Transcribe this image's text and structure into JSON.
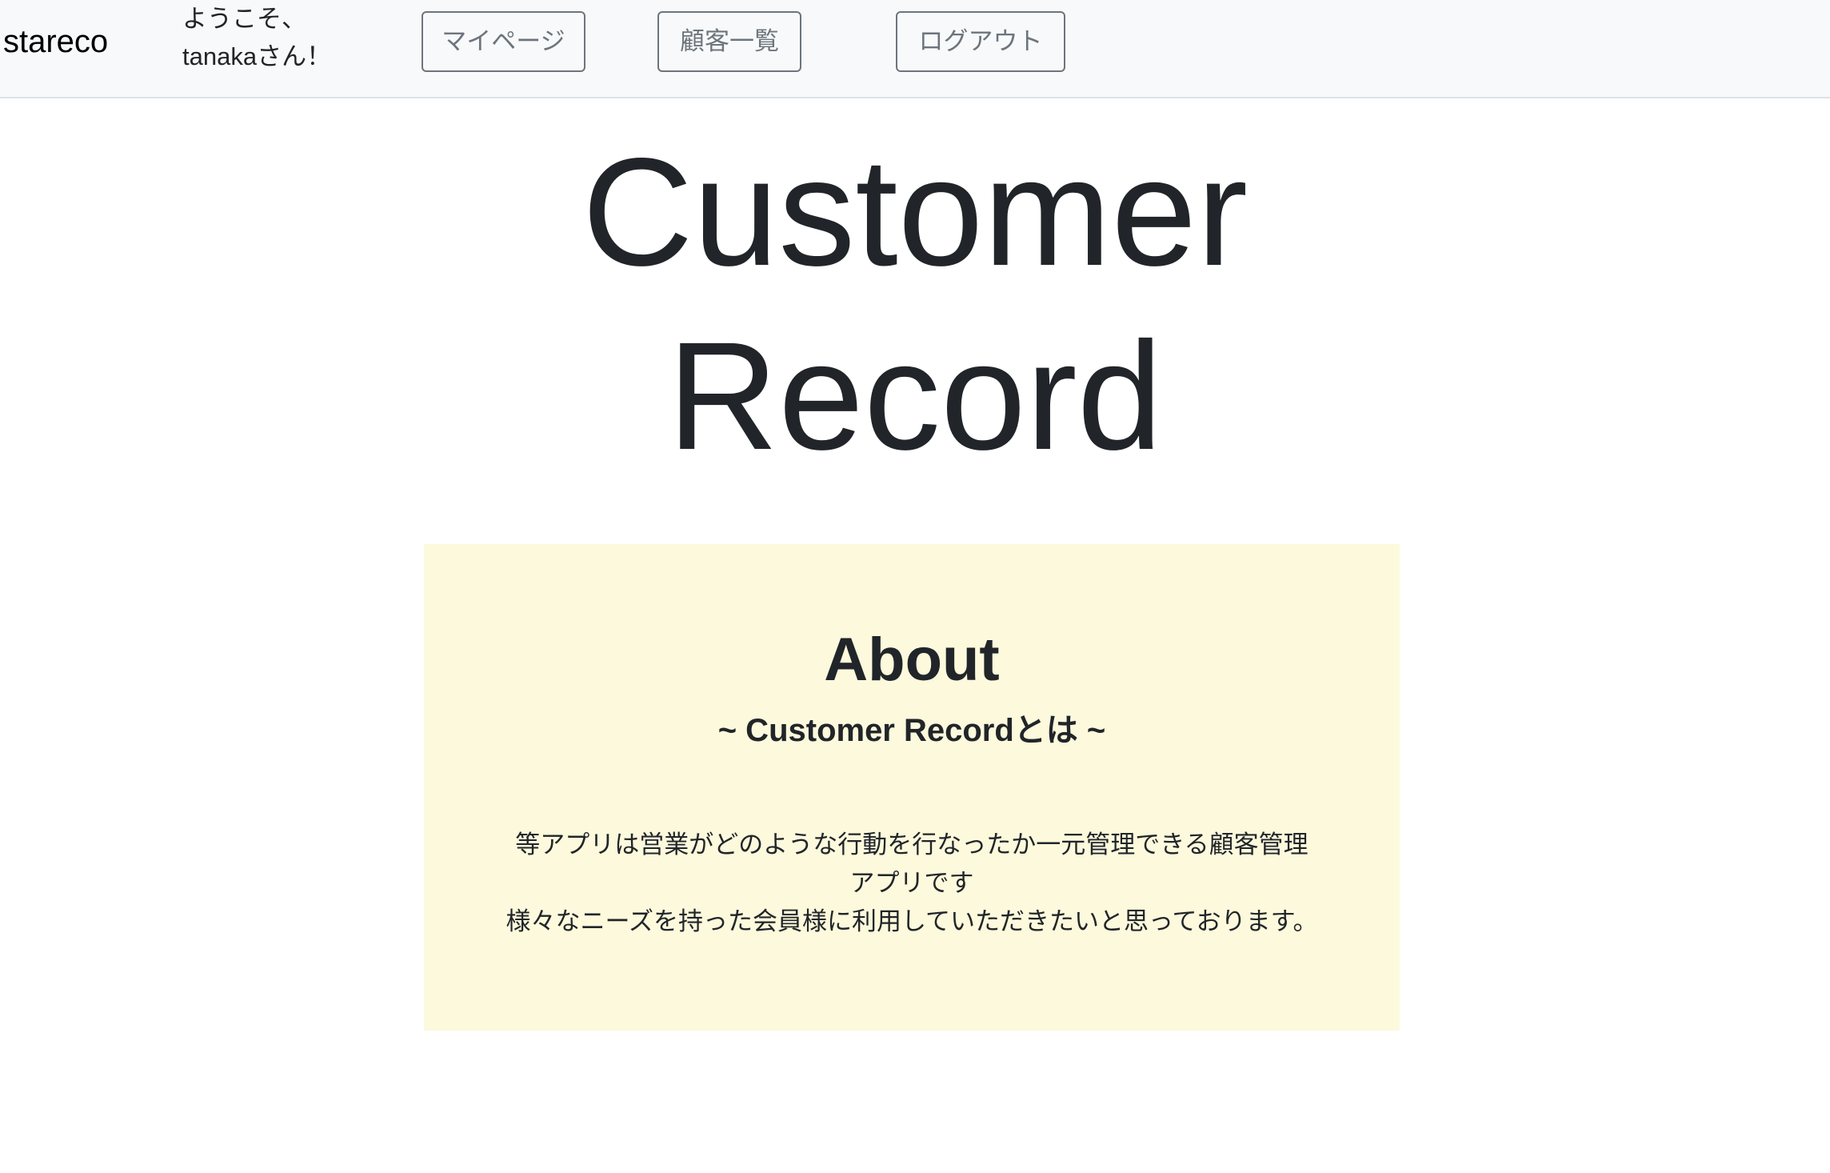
{
  "navbar": {
    "brand": "stareco",
    "welcome_line1": "ようこそ、",
    "welcome_line2": "tanakaさん！",
    "mypage_label": "マイページ",
    "customers_label": "顧客一覧",
    "logout_label": "ログアウト"
  },
  "hero": {
    "title_line1": "Customer",
    "title_line2": "Record"
  },
  "about": {
    "heading": "About",
    "subheading": "~ Customer Recordとは ~",
    "paragraph1": "等アプリは営業がどのような行動を行なったか一元管理できる顧客管理アプリです",
    "paragraph2": "様々なニーズを持った会員様に利用していただきたいと思っております。"
  },
  "colors": {
    "navbar_bg": "#f8f9fa",
    "button_border": "#6c757d",
    "about_bg": "#fdf9dc",
    "text": "#212529"
  }
}
